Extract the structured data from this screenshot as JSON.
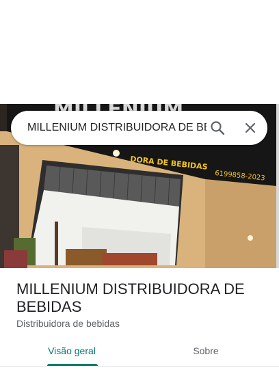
{
  "search": {
    "query": "MILLENIUM DISTRIBUIDORA DE BEBIDAS",
    "search_icon": "search-icon",
    "close_icon": "close-icon"
  },
  "photo": {
    "sign_text": "MILLENIUM",
    "sign_subtext": "DISTRIBUIDORA DE BEBIDAS",
    "phone": "6199858-2023",
    "sign_color": "#f2c21b"
  },
  "place": {
    "name": "MILLENIUM DISTRIBUIDORA DE BEBIDAS",
    "category": "Distribuidora de bebidas"
  },
  "tabs": [
    {
      "label": "Visão geral",
      "active": true
    },
    {
      "label": "Sobre",
      "active": false
    }
  ],
  "colors": {
    "accent": "#00796b",
    "text_primary": "#202124",
    "text_secondary": "#5f6368"
  }
}
